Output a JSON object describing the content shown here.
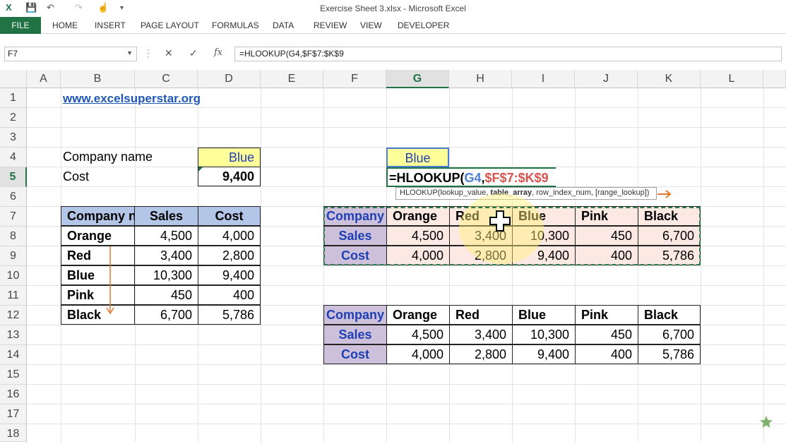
{
  "window": {
    "title": "Exercise Sheet 3.xlsx - Microsoft Excel"
  },
  "ribbon": {
    "tabs": [
      "FILE",
      "HOME",
      "INSERT",
      "PAGE LAYOUT",
      "FORMULAS",
      "DATA",
      "REVIEW",
      "VIEW",
      "DEVELOPER"
    ]
  },
  "formula_bar": {
    "name_box": "F7",
    "formula": "=HLOOKUP(G4,$F$7:$K$9"
  },
  "columns": [
    "A",
    "B",
    "C",
    "D",
    "E",
    "F",
    "G",
    "H",
    "I",
    "J",
    "K",
    "L"
  ],
  "rows": [
    "1",
    "2",
    "3",
    "4",
    "5",
    "6",
    "7",
    "8",
    "9",
    "10",
    "11",
    "12",
    "13",
    "14",
    "15",
    "16",
    "17",
    "18"
  ],
  "sheet": {
    "link": "www.excelsuperstar.org",
    "company_label": "Company name",
    "company_value": "Blue",
    "cost_label": "Cost",
    "cost_value": "9,400",
    "lookup_value": "Blue",
    "edit_formula_prefix": "=HLOOKUP(",
    "edit_formula_ref1": "G4",
    "edit_formula_sep": ",",
    "edit_formula_ref2": "$F$7:$K$9",
    "tooltip_prefix": "HLOOKUP(lookup_value, ",
    "tooltip_bold": "table_array",
    "tooltip_suffix": ", row_index_num, [range_lookup])",
    "vtable": {
      "headers": [
        "Company na",
        "Sales",
        "Cost"
      ],
      "rows": [
        [
          "Orange",
          "4,500",
          "4,000"
        ],
        [
          "Red",
          "3,400",
          "2,800"
        ],
        [
          "Blue",
          "10,300",
          "9,400"
        ],
        [
          "Pink",
          "450",
          "400"
        ],
        [
          "Black",
          "6,700",
          "5,786"
        ]
      ]
    },
    "htable1": {
      "header_row": [
        "Company",
        "Orange",
        "Red",
        "Blue",
        "Pink",
        "Black"
      ],
      "sales_row": [
        "Sales",
        "4,500",
        "3,400",
        "10,300",
        "450",
        "6,700"
      ],
      "cost_row": [
        "Cost",
        "4,000",
        "2,800",
        "9,400",
        "400",
        "5,786"
      ]
    },
    "htable2": {
      "header_row": [
        "Company",
        "Orange",
        "Red",
        "Blue",
        "Pink",
        "Black"
      ],
      "sales_row": [
        "Sales",
        "4,500",
        "3,400",
        "10,300",
        "450",
        "6,700"
      ],
      "cost_row": [
        "Cost",
        "4,000",
        "2,800",
        "9,400",
        "400",
        "5,786"
      ]
    }
  },
  "colors": {
    "excel_green": "#217346",
    "header_blue": "#b4c6e7",
    "row_purple": "#ccc0da",
    "input_yellow": "#ffff99",
    "arrow_orange": "#e07a2e"
  }
}
